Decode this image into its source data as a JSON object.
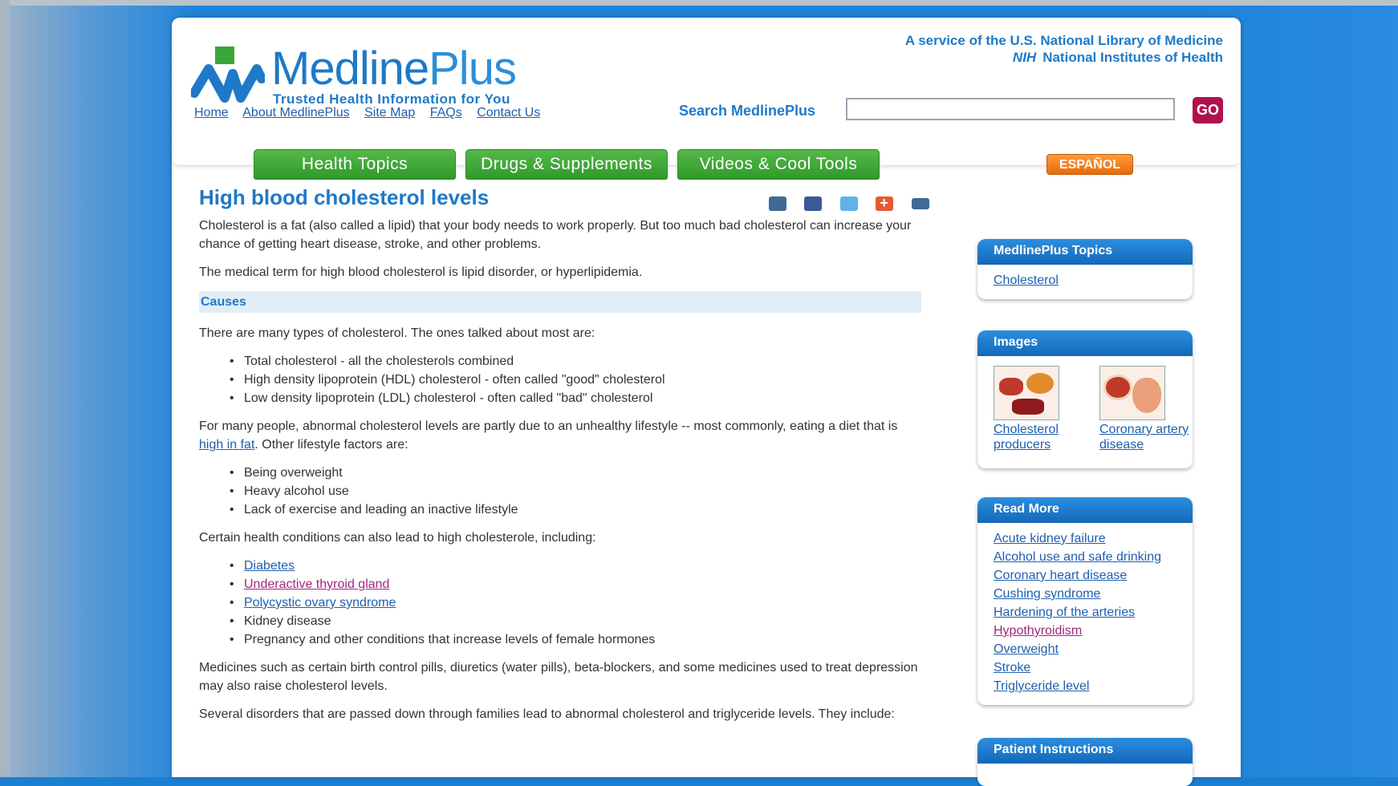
{
  "header": {
    "logo_name_1": "Medline",
    "logo_name_2": "Plus",
    "tagline": "Trusted Health Information for You",
    "service_line": "A service of the U.S. National Library of Medicine",
    "nih_abbr": "NIH",
    "nih_name": "National Institutes of Health",
    "links": [
      "Home",
      "About MedlinePlus",
      "Site Map",
      "FAQs",
      "Contact Us"
    ],
    "search_label": "Search MedlinePlus",
    "search_value": "",
    "go_label": "GO"
  },
  "nav": {
    "tabs": [
      "Health Topics",
      "Drugs & Supplements",
      "Videos & Cool Tools"
    ],
    "espanol": "ESPAÑOL"
  },
  "article": {
    "title": "High blood cholesterol levels",
    "share_icons": [
      "email-icon",
      "facebook-icon",
      "twitter-icon",
      "add-icon",
      "print-icon"
    ],
    "intro_1": "Cholesterol is a fat (also called a lipid) that your body needs to work properly. But too much bad cholesterol can increase your chance of getting heart disease, stroke, and other problems.",
    "intro_2": "The medical term for high blood cholesterol is lipid disorder, or hyperlipidemia.",
    "causes_heading": "Causes",
    "types_intro": "There are many types of cholesterol. The ones talked about most are:",
    "types": [
      "Total cholesterol - all the cholesterols combined",
      "High density lipoprotein (HDL) cholesterol - often called \"good\" cholesterol",
      "Low density lipoprotein (LDL) cholesterol - often called \"bad\" cholesterol"
    ],
    "lifestyle_pre": "For many people, abnormal cholesterol levels are partly due to an unhealthy lifestyle -- most commonly, eating a diet that is ",
    "lifestyle_link": "high in fat",
    "lifestyle_post": ". Other lifestyle factors are:",
    "lifestyle_factors": [
      "Being overweight",
      "Heavy alcohol use",
      "Lack of exercise and leading an inactive lifestyle"
    ],
    "conditions_intro": "Certain health conditions can also lead to high cholesterole, including:",
    "conditions": [
      {
        "text": "Diabetes",
        "type": "link"
      },
      {
        "text": "Underactive thyroid gland",
        "type": "visited"
      },
      {
        "text": "Polycystic ovary syndrome",
        "type": "link"
      },
      {
        "text": "Kidney disease",
        "type": "text"
      },
      {
        "text": "Pregnancy and other conditions that increase levels of female hormones",
        "type": "text"
      }
    ],
    "medicines": "Medicines such as certain birth control pills, diuretics (water pills), beta-blockers, and some medicines used to treat depression may also raise cholesterol levels.",
    "disorders": "Several disorders that are passed down through families lead to abnormal cholesterol and triglyceride levels. They include:"
  },
  "sidebar": {
    "topics": {
      "title": "MedlinePlus Topics",
      "items": [
        "Cholesterol"
      ]
    },
    "images": {
      "title": "Images",
      "items": [
        {
          "line1": "Cholesterol",
          "line2": "producers"
        },
        {
          "line1": "Coronary artery",
          "line2": "disease"
        }
      ]
    },
    "read_more": {
      "title": "Read More",
      "items": [
        {
          "text": "Acute kidney failure",
          "visited": false
        },
        {
          "text": "Alcohol use and safe drinking",
          "visited": false
        },
        {
          "text": "Coronary heart disease",
          "visited": false
        },
        {
          "text": "Cushing syndrome",
          "visited": false
        },
        {
          "text": "Hardening of the arteries",
          "visited": false
        },
        {
          "text": "Hypothyroidism",
          "visited": true
        },
        {
          "text": "Overweight",
          "visited": false
        },
        {
          "text": "Stroke",
          "visited": false
        },
        {
          "text": "Triglyceride level",
          "visited": false
        }
      ]
    },
    "patient": {
      "title": "Patient Instructions"
    }
  },
  "colors": {
    "brand_blue": "#1f79c8",
    "nav_green": "#2f9a2a",
    "go_magenta": "#b0124f",
    "espanol_orange": "#e76b09",
    "visited_link": "#a1277a"
  }
}
